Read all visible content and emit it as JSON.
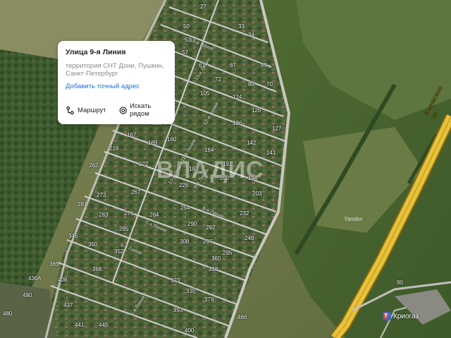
{
  "card": {
    "title": "Улица 9-я Линия",
    "subtitle": "территория СНТ Дони, Пушкин, Санкт-Петербург",
    "add_address_link": "Добавить точный адрес",
    "route_button": "Маршрут",
    "search_nearby_button": "Искать рядом"
  },
  "map": {
    "watermark": "ВЛАДИС",
    "provider_mark": "Yandex",
    "highway_label": "Киевское ш.",
    "poi_label": "Криогаз",
    "house_numbers": [
      "27",
      "50",
      "33",
      "34",
      "53",
      "59",
      "57",
      "61",
      "67",
      "72",
      "89",
      "70",
      "105",
      "124",
      "126",
      "127",
      "161",
      "142",
      "136",
      "160",
      "167",
      "169",
      "141",
      "164",
      "219",
      "222",
      "191",
      "203",
      "194",
      "226",
      "182",
      "202",
      "262",
      "267",
      "273",
      "254",
      "232",
      "281",
      "276",
      "283",
      "290",
      "292",
      "264",
      "285",
      "297",
      "248",
      "346",
      "308",
      "295",
      "352",
      "350",
      "365",
      "360",
      "318",
      "408",
      "368",
      "373",
      "335",
      "436А",
      "490",
      "437",
      "379",
      "393",
      "466",
      "480",
      "445",
      "400",
      "441",
      "90"
    ],
    "street_labels": [
      "14-я Линия",
      "13-я Линия",
      "12-я Линия",
      "11-я Линия",
      "10-я Линия",
      "9-я Линия",
      "8-я Линия",
      "7-я Линия",
      "6-я Линия",
      "5-я Линия"
    ],
    "colors": {
      "field": "#6f7a4a",
      "road": "#d8d8d8",
      "highway": "#e8c23a",
      "link": "#1e6fd9"
    }
  }
}
